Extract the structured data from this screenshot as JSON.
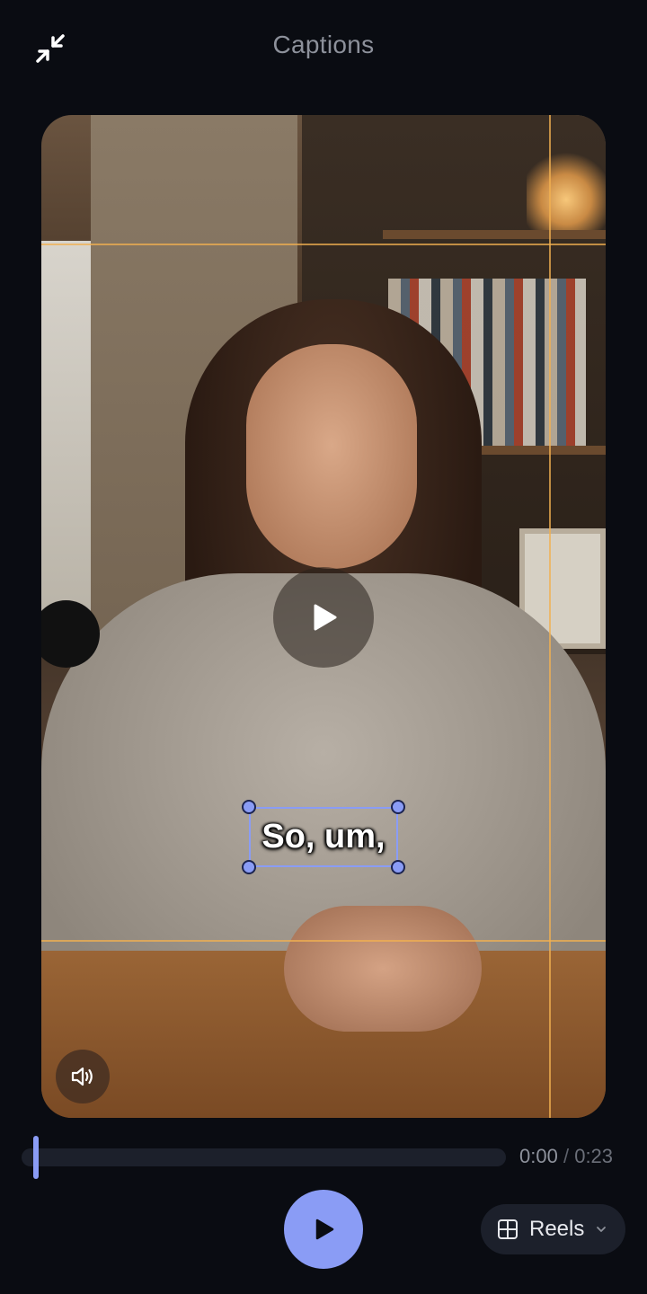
{
  "header": {
    "title": "Captions",
    "collapse_icon": "collapse-arrows-icon"
  },
  "player": {
    "center_icon": "play-icon",
    "sound_icon": "speaker-icon",
    "caption": {
      "text": "So, um,",
      "outline_color": "#8a9cf5"
    },
    "guide_color": "#f2b050"
  },
  "timeline": {
    "current_time": "0:00",
    "separator": "/",
    "total_time": "0:23",
    "progress": 0.0
  },
  "controls": {
    "play_icon": "play-icon",
    "accent_color": "#8a9cf5",
    "format": {
      "label": "Reels",
      "icon": "grid-icon",
      "chevron": "chevron-down-icon"
    }
  }
}
